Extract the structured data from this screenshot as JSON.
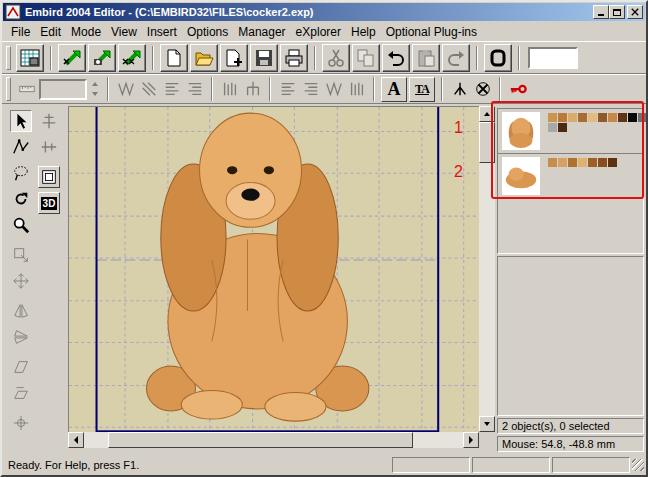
{
  "window": {
    "title": "Embird 2004 Editor - (C:\\EMBIRD32\\FILES\\cocker2.exp)"
  },
  "menu": [
    "File",
    "Edit",
    "Mode",
    "View",
    "Insert",
    "Options",
    "Manager",
    "eXplorer",
    "Help",
    "Optional Plug-ins"
  ],
  "toolbar_main": {
    "groups": [
      [
        {
          "disabled": false
        }
      ],
      [
        {
          "disabled": false
        },
        {
          "disabled": false
        },
        {
          "disabled": false
        }
      ],
      [
        {
          "disabled": false
        },
        {
          "disabled": false
        },
        {
          "disabled": false
        },
        {
          "disabled": false
        },
        {
          "disabled": false
        }
      ],
      [
        {
          "disabled": true
        },
        {
          "disabled": true
        },
        {
          "disabled": false
        },
        {
          "disabled": true
        },
        {
          "disabled": true
        }
      ],
      [
        {
          "disabled": false
        }
      ]
    ],
    "field": {
      "value": ""
    }
  },
  "toolbar_format": {
    "lead": {
      "disabled": true
    },
    "field": {
      "value": "",
      "disabled": true
    },
    "groups": [
      [
        {
          "kind": "icon",
          "disabled": true
        },
        {
          "kind": "icon",
          "disabled": true
        },
        {
          "kind": "icon",
          "disabled": true
        },
        {
          "kind": "icon",
          "disabled": true
        }
      ],
      [
        {
          "kind": "icon",
          "disabled": true
        },
        {
          "kind": "icon",
          "disabled": true
        }
      ],
      [
        {
          "kind": "icon",
          "disabled": true
        },
        {
          "kind": "icon",
          "disabled": true
        },
        {
          "kind": "icon",
          "disabled": true
        },
        {
          "kind": "icon",
          "disabled": true
        }
      ],
      [
        {
          "kind": "glyph",
          "glyph": "A",
          "disabled": false
        },
        {
          "kind": "glyph",
          "glyph": "TA",
          "disabled": false
        }
      ],
      [
        {
          "kind": "icon",
          "disabled": false
        },
        {
          "kind": "icon",
          "disabled": false
        }
      ],
      [
        {
          "kind": "icon",
          "disabled": false
        }
      ]
    ]
  },
  "tools_left": {
    "columns": [
      [
        [
          {
            "kind": "icon",
            "selected": true,
            "disabled": false
          },
          {
            "kind": "icon",
            "selected": false,
            "disabled": false
          },
          {
            "kind": "icon",
            "selected": false,
            "disabled": false
          },
          {
            "kind": "icon",
            "selected": false,
            "disabled": false
          },
          {
            "kind": "icon",
            "selected": false,
            "disabled": false
          }
        ],
        [
          {
            "kind": "icon",
            "selected": false,
            "disabled": true
          },
          {
            "kind": "icon",
            "selected": false,
            "disabled": true
          }
        ],
        [
          {
            "kind": "icon",
            "selected": false,
            "disabled": true
          },
          {
            "kind": "icon",
            "selected": false,
            "disabled": true
          }
        ],
        [
          {
            "kind": "icon",
            "selected": false,
            "disabled": true
          },
          {
            "kind": "icon",
            "selected": false,
            "disabled": true
          }
        ],
        [
          {
            "kind": "icon",
            "selected": false,
            "disabled": true
          }
        ]
      ],
      [
        [
          {
            "kind": "icon",
            "selected": false,
            "disabled": true
          },
          {
            "kind": "icon",
            "selected": false,
            "disabled": true
          }
        ],
        [
          {
            "kind": "icon",
            "selected": false,
            "disabled": false
          },
          {
            "kind": "glyph",
            "glyph": "3D",
            "selected": false,
            "disabled": false
          }
        ]
      ]
    ]
  },
  "canvas": {
    "vertical_scroll": {
      "level": 0.14
    },
    "horizontal_scroll": {
      "level": 0.86
    }
  },
  "objects": [
    {
      "label": "1",
      "selected": false,
      "colors": [
        "#c8964f",
        "#b97a3a",
        "#d9ab6c",
        "#a86c34",
        "#e2bb80",
        "#8e5a2a",
        "#c58848",
        "#5e3516",
        "#0a0a0a",
        "#6e6e6e",
        "#a8a8a8",
        "#4a2a10"
      ]
    },
    {
      "label": "2",
      "selected": false,
      "colors": [
        "#c88c4c",
        "#d4a262",
        "#b0702e",
        "#e0b272",
        "#9e6026",
        "#8a4e1e",
        "#5c3210"
      ]
    }
  ],
  "info": {
    "count": "2 object(s), 0 selected",
    "mouse": "Mouse: 54.8, -48.8 mm"
  },
  "status_bar": {
    "message": "Ready. For Help, press F1.",
    "panels": [
      "",
      "",
      ""
    ]
  }
}
